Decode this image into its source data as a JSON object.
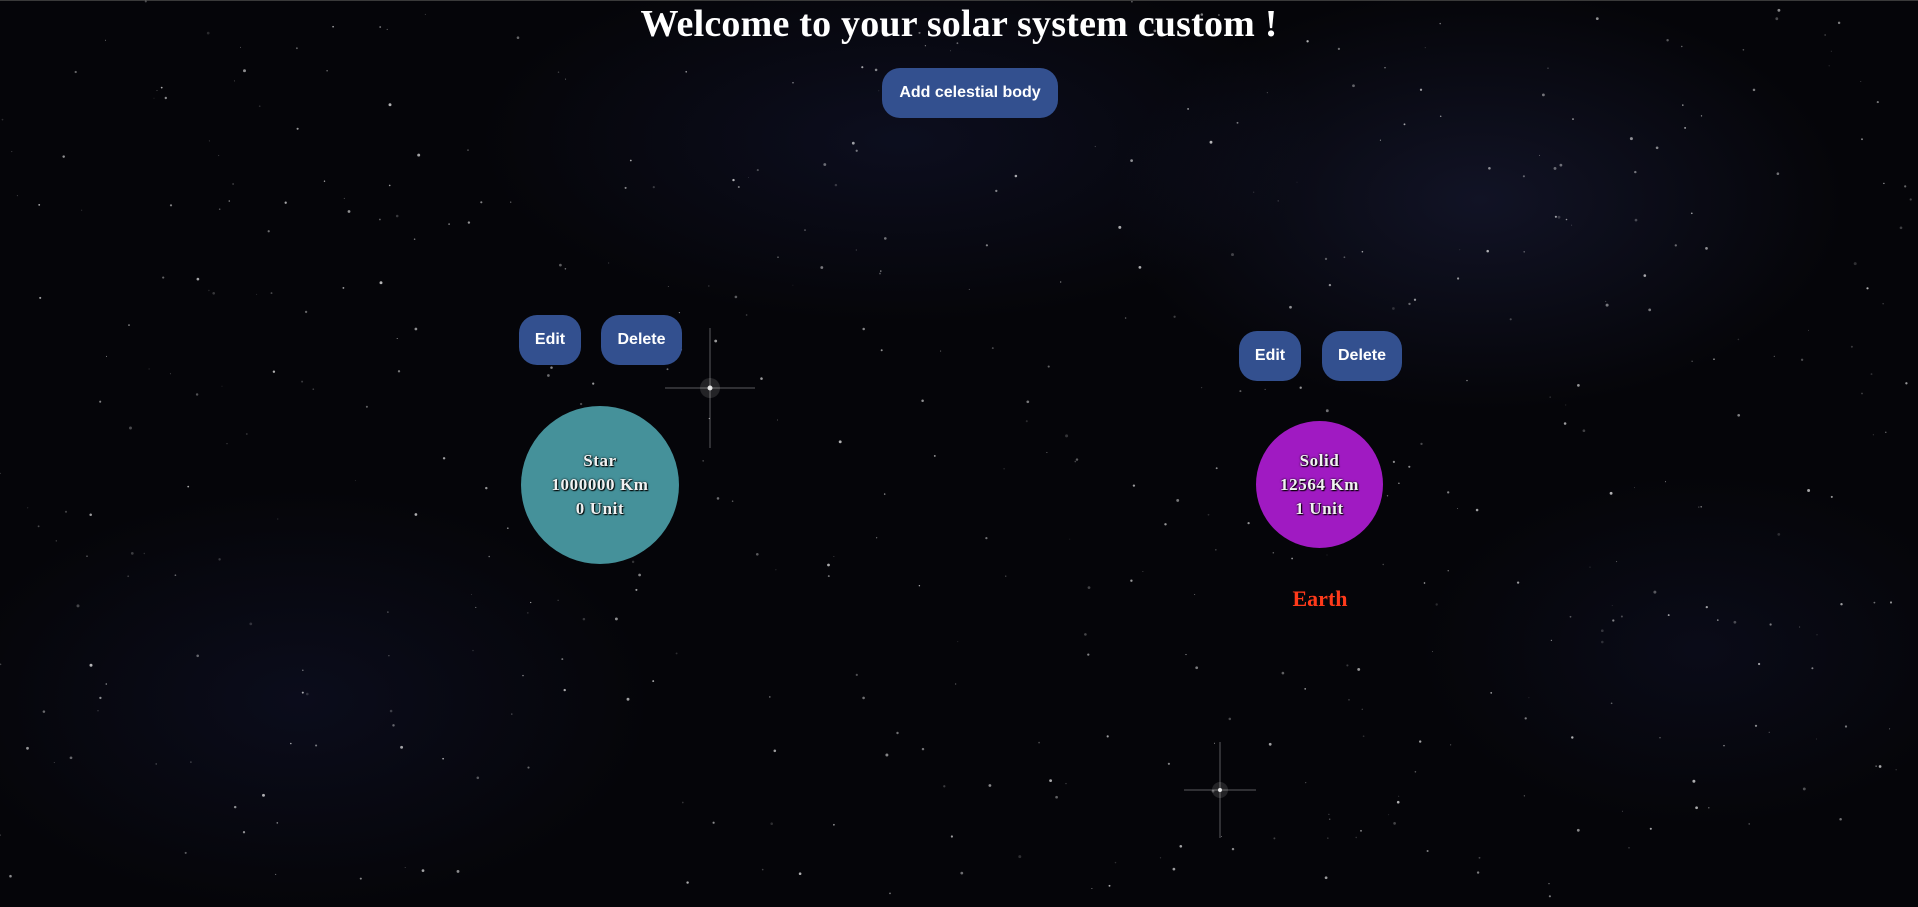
{
  "page": {
    "title": "Welcome to your solar system custom !",
    "add_button_label": "Add celestial body"
  },
  "bodies": [
    {
      "type": "Star",
      "size": "1000000 Km",
      "distance": "0 Unit",
      "name": "",
      "color": "#45919a",
      "edit_label": "Edit",
      "delete_label": "Delete"
    },
    {
      "type": "Solid",
      "size": "12564 Km",
      "distance": "1 Unit",
      "name": "Earth",
      "color": "#a01ac2",
      "name_color": "#ff3a1a",
      "edit_label": "Edit",
      "delete_label": "Delete"
    }
  ],
  "theme": {
    "button_color": "#33508f",
    "background": "starfield"
  }
}
